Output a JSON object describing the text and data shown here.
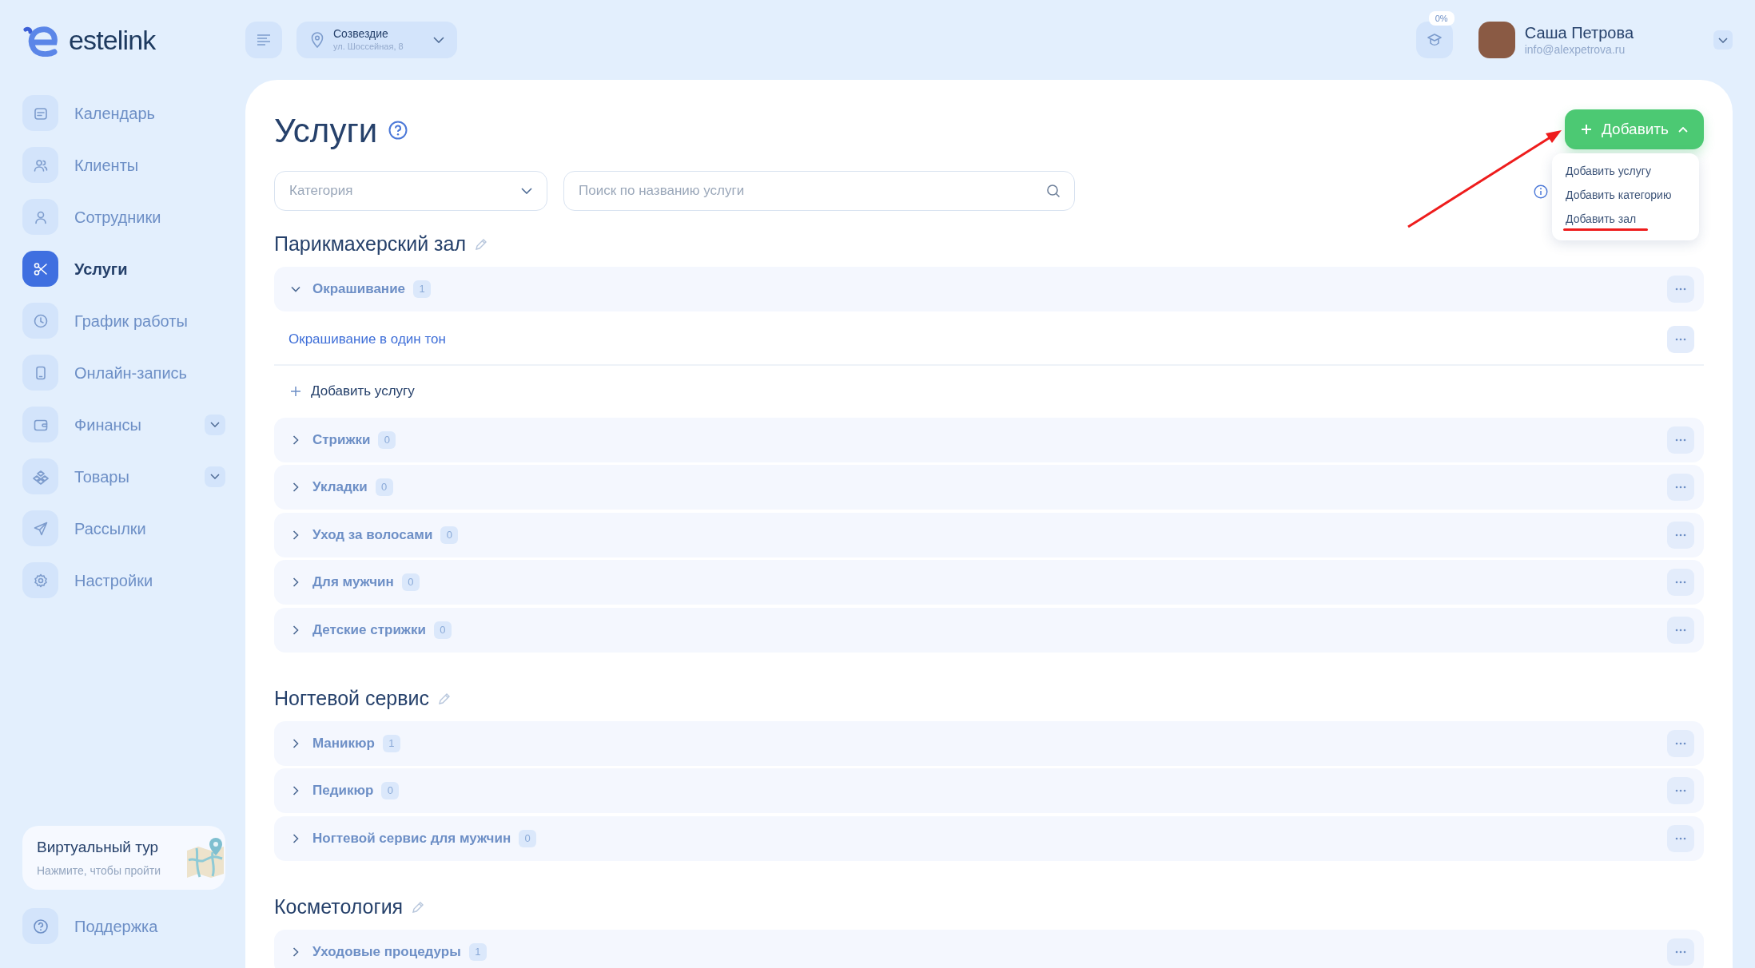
{
  "logo": "estelink",
  "location": {
    "name": "Созвездие",
    "address": "ул. Шоссейная, 8"
  },
  "progress_badge": "0%",
  "user": {
    "name": "Саша Петрова",
    "email": "info@alexpetrova.ru"
  },
  "sidebar": {
    "items": [
      {
        "label": "Календарь",
        "selected": false,
        "expandable": false
      },
      {
        "label": "Клиенты",
        "selected": false,
        "expandable": false
      },
      {
        "label": "Сотрудники",
        "selected": false,
        "expandable": false
      },
      {
        "label": "Услуги",
        "selected": true,
        "expandable": false
      },
      {
        "label": "График работы",
        "selected": false,
        "expandable": false
      },
      {
        "label": "Онлайн-запись",
        "selected": false,
        "expandable": false
      },
      {
        "label": "Финансы",
        "selected": false,
        "expandable": true
      },
      {
        "label": "Товары",
        "selected": false,
        "expandable": true
      },
      {
        "label": "Рассылки",
        "selected": false,
        "expandable": false
      },
      {
        "label": "Настройки",
        "selected": false,
        "expandable": false
      }
    ]
  },
  "tour": {
    "title": "Виртуальный тур",
    "subtitle": "Нажмите, чтобы пройти"
  },
  "support": "Поддержка",
  "page_title": "Услуги",
  "filters": {
    "category_placeholder": "Категория",
    "search_placeholder": "Поиск по названию услуги"
  },
  "add_button": {
    "label": "Добавить",
    "expanded": true
  },
  "add_menu": [
    {
      "label": "Добавить услугу",
      "highlighted": false
    },
    {
      "label": "Добавить категорию",
      "highlighted": false
    },
    {
      "label": "Добавить зал",
      "highlighted": true
    }
  ],
  "sections": [
    {
      "title": "Парикмахерский зал",
      "categories": [
        {
          "name": "Окрашивание",
          "count": "1",
          "expanded": true,
          "services": [
            "Окрашивание в один тон"
          ],
          "add_service": "Добавить услугу"
        },
        {
          "name": "Стрижки",
          "count": "0",
          "expanded": false
        },
        {
          "name": "Укладки",
          "count": "0",
          "expanded": false
        },
        {
          "name": "Уход за волосами",
          "count": "0",
          "expanded": false
        },
        {
          "name": "Для мужчин",
          "count": "0",
          "expanded": false
        },
        {
          "name": "Детские стрижки",
          "count": "0",
          "expanded": false
        }
      ]
    },
    {
      "title": "Ногтевой сервис",
      "categories": [
        {
          "name": "Маникюр",
          "count": "1",
          "expanded": false
        },
        {
          "name": "Педикюр",
          "count": "0",
          "expanded": false
        },
        {
          "name": "Ногтевой сервис для мужчин",
          "count": "0",
          "expanded": false
        }
      ]
    },
    {
      "title": "Косметология",
      "categories": [
        {
          "name": "Уходовые процедуры",
          "count": "1",
          "expanded": false
        }
      ]
    }
  ]
}
